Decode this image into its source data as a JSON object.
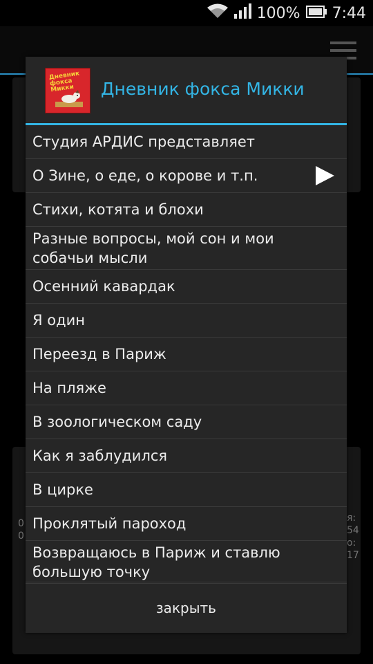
{
  "status_bar": {
    "battery": "100%",
    "time": "7:44"
  },
  "dialog": {
    "title": "Дневник фокса Микки",
    "cover_text": "Дневник фокса Микки",
    "items": [
      {
        "label": "Студия АРДИС представляет",
        "playing": false
      },
      {
        "label": "О Зине, о еде, о корове и т.п.",
        "playing": true
      },
      {
        "label": "Стихи, котята и блохи",
        "playing": false
      },
      {
        "label": "Разные вопросы, мой сон и мои собачьи мысли",
        "playing": false
      },
      {
        "label": "Осенний кавардак",
        "playing": false
      },
      {
        "label": "Я один",
        "playing": false
      },
      {
        "label": "Переезд в Париж",
        "playing": false
      },
      {
        "label": "На пляже",
        "playing": false
      },
      {
        "label": "В зоологическом саду",
        "playing": false
      },
      {
        "label": "Как я заблудился",
        "playing": false
      },
      {
        "label": "В цирке",
        "playing": false
      },
      {
        "label": "Проклятый пароход",
        "playing": false
      },
      {
        "label": "Возвращаюсь в Париж и ставлю большую точку",
        "playing": false
      }
    ],
    "close_label": "закрыть"
  },
  "background": {
    "left_edge_text": [
      "0!",
      "0!"
    ],
    "right_edge_text": [
      "я:",
      "54",
      "о:",
      "17"
    ]
  },
  "colors": {
    "accent": "#33b5e5",
    "dialog_bg": "#262626",
    "divider": "#3a3a3a"
  }
}
